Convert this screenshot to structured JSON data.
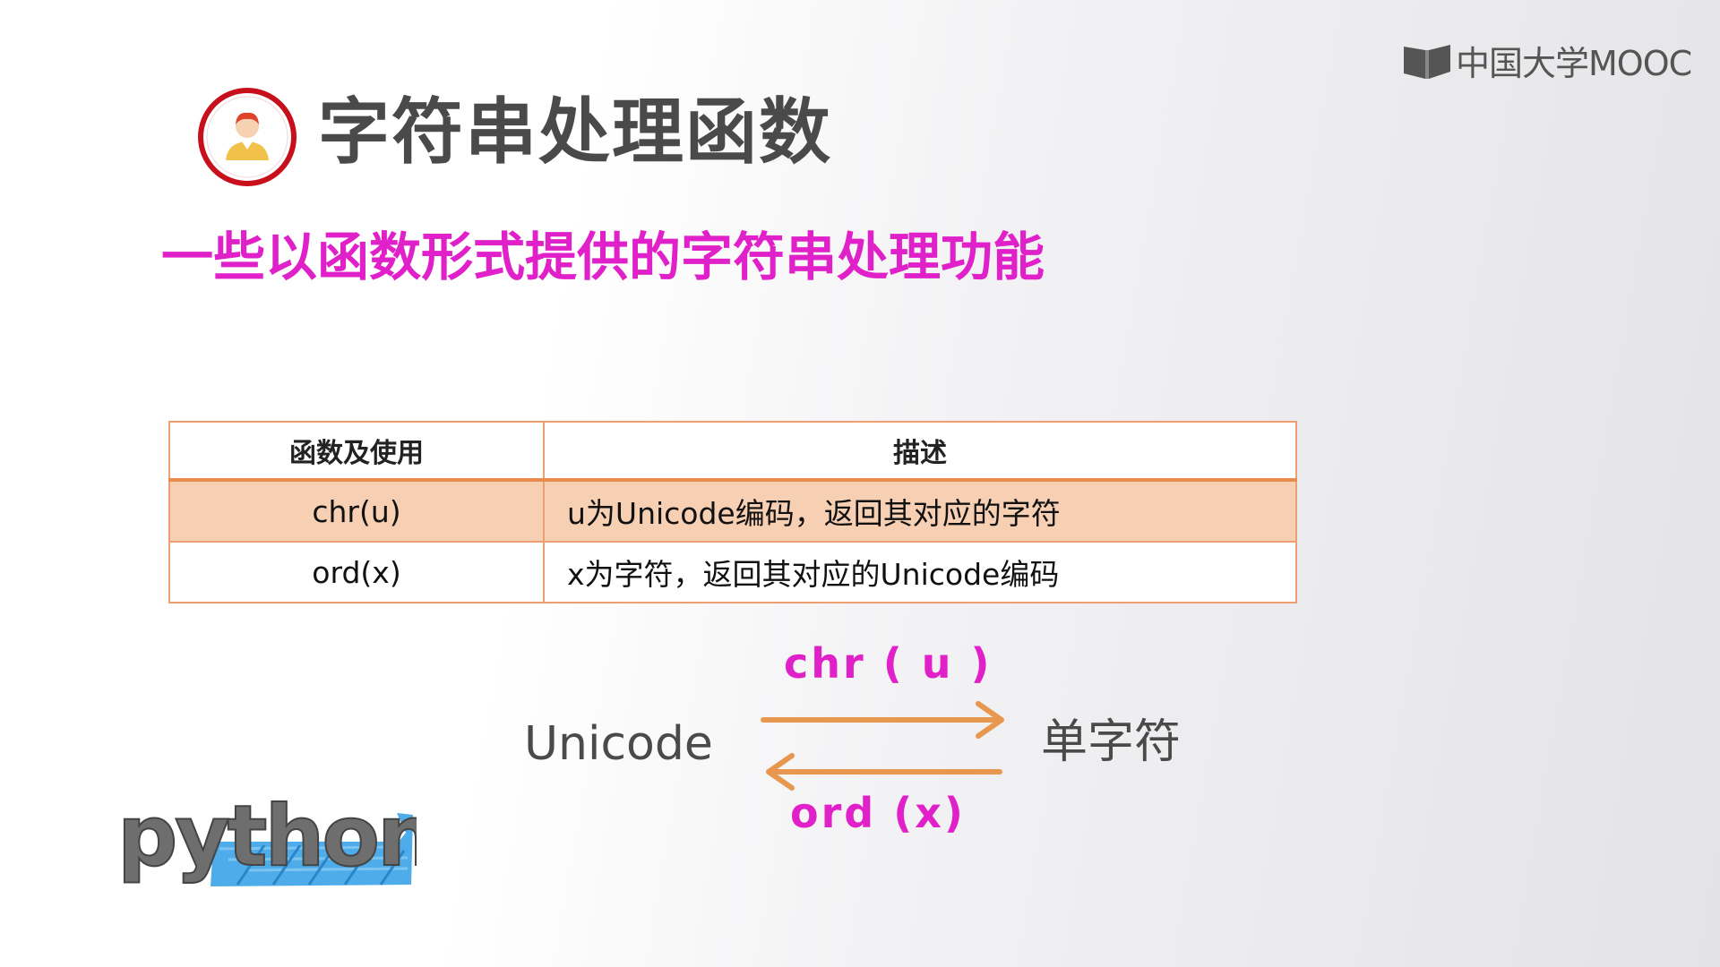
{
  "brand": {
    "name": "中国大学MOOC"
  },
  "slide": {
    "title": "字符串处理函数",
    "subtitle": "一些以函数形式提供的字符串处理功能"
  },
  "table": {
    "headers": [
      "函数及使用",
      "描述"
    ],
    "rows": [
      {
        "func": "chr(u)",
        "desc": "u为Unicode编码，返回其对应的字符",
        "highlighted": true
      },
      {
        "func": "ord(x)",
        "desc": "x为字符，返回其对应的Unicode编码",
        "highlighted": false
      }
    ]
  },
  "conversion": {
    "left_label": "Unicode",
    "right_label": "单字符",
    "forward_fn": "chr ( u )",
    "backward_fn": "ord (x)"
  },
  "python_logo": {
    "text": "python"
  },
  "colors": {
    "accent_magenta": "#e020c8",
    "arrow_orange": "#e8974f",
    "table_border": "#eca072",
    "row_highlight": "#f7cfb3",
    "avatar_ring": "#c8101c",
    "python_blue": "#3ba3e8"
  }
}
